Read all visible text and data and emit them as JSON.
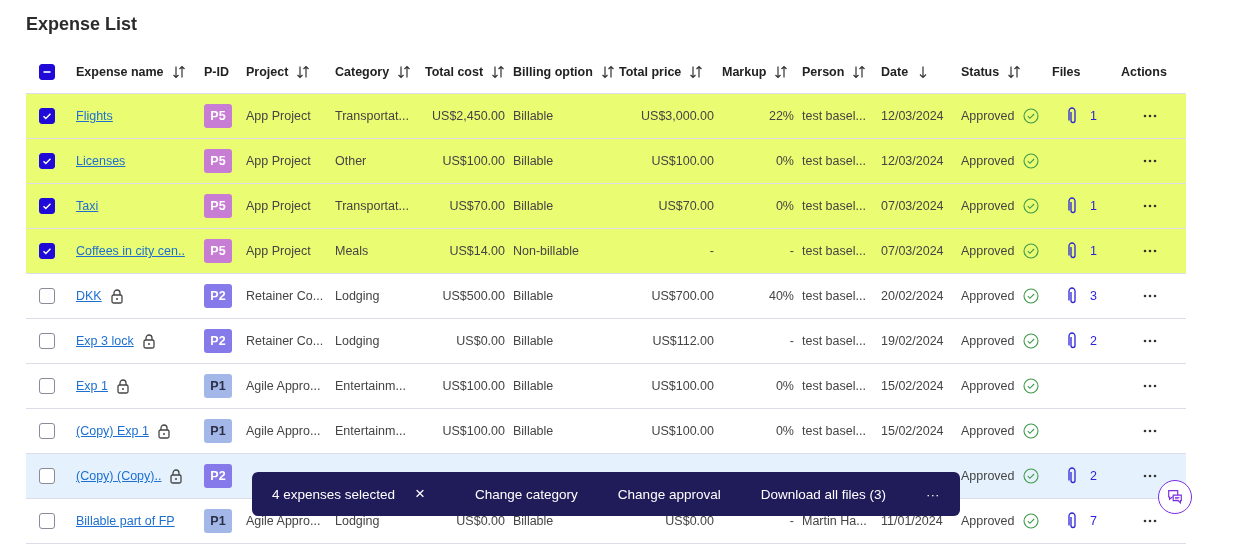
{
  "title": "Expense List",
  "header_checkbox": {
    "indeterminate": true
  },
  "columns": [
    {
      "kind": "check"
    },
    {
      "label": "Expense name",
      "sortable": true
    },
    {
      "label": "P-ID"
    },
    {
      "label": "Project",
      "sortable": true
    },
    {
      "label": "Category",
      "sortable": true
    },
    {
      "label": "Total cost",
      "sortable": true
    },
    {
      "label": "Billing option",
      "sortable": true
    },
    {
      "label": "Total price",
      "sortable": true
    },
    {
      "label": "Markup",
      "sortable": true
    },
    {
      "label": "Person",
      "sortable": true
    },
    {
      "label": "Date",
      "sortable": true,
      "sorted_desc": true
    },
    {
      "label": "Status",
      "sortable": true
    },
    {
      "label": "Files"
    },
    {
      "label": "Actions"
    }
  ],
  "rows": [
    {
      "selected": true,
      "highlighted": false,
      "name": "Flights",
      "locked": false,
      "pid": "P5",
      "color": "#c77dd3",
      "project": "App Project",
      "category": "Transportat...",
      "total_cost": "US$2,450.00",
      "billing": "Billable",
      "total_price": "US$3,000.00",
      "markup": "22%",
      "person": "test basel...",
      "date": "12/03/2024",
      "status": "Approved",
      "files": "1"
    },
    {
      "selected": true,
      "highlighted": false,
      "name": "Licenses",
      "locked": false,
      "pid": "P5",
      "color": "#c77dd3",
      "project": "App Project",
      "category": "Other",
      "total_cost": "US$100.00",
      "billing": "Billable",
      "total_price": "US$100.00",
      "markup": "0%",
      "person": "test basel...",
      "date": "12/03/2024",
      "status": "Approved"
    },
    {
      "selected": true,
      "highlighted": false,
      "name": "Taxi",
      "locked": false,
      "pid": "P5",
      "color": "#c77dd3",
      "project": "App Project",
      "category": "Transportat...",
      "total_cost": "US$70.00",
      "billing": "Billable",
      "total_price": "US$70.00",
      "markup": "0%",
      "person": "test basel...",
      "date": "07/03/2024",
      "status": "Approved",
      "files": "1"
    },
    {
      "selected": true,
      "highlighted": false,
      "name": "Coffees in city cen..",
      "locked": false,
      "pid": "P5",
      "color": "#c77dd3",
      "project": "App Project",
      "category": "Meals",
      "total_cost": "US$14.00",
      "billing": "Non-billable",
      "total_price": "-",
      "markup": "-",
      "person": "test basel...",
      "date": "07/03/2024",
      "status": "Approved",
      "files": "1"
    },
    {
      "selected": false,
      "highlighted": false,
      "name": "DKK",
      "locked": true,
      "pid": "P2",
      "color": "#8679ea",
      "project": "Retainer Co...",
      "category": "Lodging",
      "total_cost": "US$500.00",
      "billing": "Billable",
      "total_price": "US$700.00",
      "markup": "40%",
      "person": "test basel...",
      "date": "20/02/2024",
      "status": "Approved",
      "files": "3"
    },
    {
      "selected": false,
      "highlighted": false,
      "name": "Exp 3 lock",
      "locked": true,
      "pid": "P2",
      "color": "#8679ea",
      "project": "Retainer Co...",
      "category": "Lodging",
      "total_cost": "US$0.00",
      "billing": "Billable",
      "total_price": "US$112.00",
      "markup": "-",
      "person": "test basel...",
      "date": "19/02/2024",
      "status": "Approved",
      "files": "2"
    },
    {
      "selected": false,
      "highlighted": false,
      "name": "Exp 1",
      "locked": true,
      "pid": "P1",
      "color": "#a3b8e8",
      "project": "Agile Appro...",
      "category": "Entertainm...",
      "total_cost": "US$100.00",
      "billing": "Billable",
      "total_price": "US$100.00",
      "markup": "0%",
      "person": "test basel...",
      "date": "15/02/2024",
      "status": "Approved"
    },
    {
      "selected": false,
      "highlighted": false,
      "name": "(Copy) Exp 1",
      "locked": true,
      "pid": "P1",
      "color": "#a3b8e8",
      "project": "Agile Appro...",
      "category": "Entertainm...",
      "total_cost": "US$100.00",
      "billing": "Billable",
      "total_price": "US$100.00",
      "markup": "0%",
      "person": "test basel...",
      "date": "15/02/2024",
      "status": "Approved"
    },
    {
      "selected": false,
      "highlighted": true,
      "name": "(Copy) (Copy)..",
      "locked": true,
      "pid": "P2",
      "color": "#8679ea",
      "status": "Approved",
      "files": "2"
    },
    {
      "selected": false,
      "highlighted": false,
      "name": "Billable part of FP",
      "locked": false,
      "pid": "P1",
      "color": "#a3b8e8",
      "project": "Agile Appro...",
      "category": "Lodging",
      "total_cost": "US$0.00",
      "billing": "Billable",
      "total_price": "US$0.00",
      "markup": "-",
      "person": "Martin Ha...",
      "date": "11/01/2024",
      "status": "Approved",
      "files": "7"
    }
  ],
  "action_bar": {
    "count": "4 expenses selected",
    "close": "×",
    "actions": [
      "Change category",
      "Change approval",
      "Download all files (3)"
    ],
    "more": "···"
  }
}
